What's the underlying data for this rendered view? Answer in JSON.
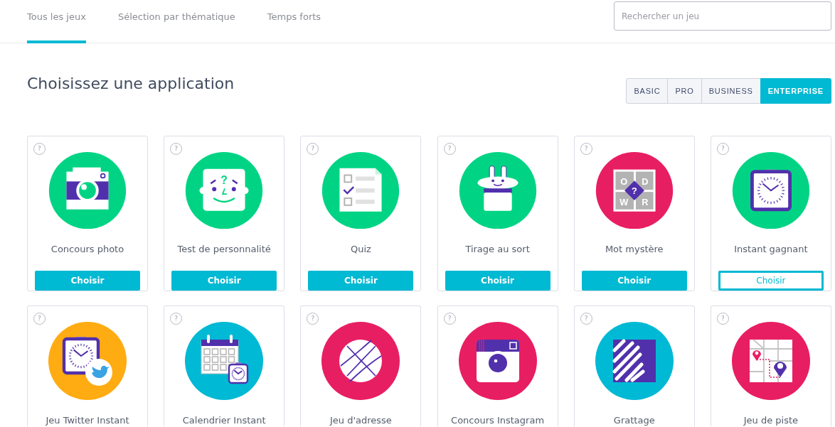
{
  "tabs": [
    {
      "label": "Tous les jeux",
      "selected": true
    },
    {
      "label": "Sélection par thématique",
      "selected": false
    },
    {
      "label": "Temps forts",
      "selected": false
    }
  ],
  "search": {
    "placeholder": "Rechercher un jeu"
  },
  "heading": "Choisissez une application",
  "plans": [
    {
      "label": "BASIC",
      "selected": false
    },
    {
      "label": "PRO",
      "selected": false
    },
    {
      "label": "BUSINESS",
      "selected": false
    },
    {
      "label": "ENTERPRISE",
      "selected": true
    }
  ],
  "games": [
    {
      "title": "Concours photo",
      "help": "?",
      "color": "#00d484",
      "button": {
        "label": "Choisir",
        "outlined": false
      }
    },
    {
      "title": "Test de personnalité",
      "help": "?",
      "color": "#00d484",
      "icon_text": [
        "?"
      ],
      "button": {
        "label": "Choisir",
        "outlined": false
      }
    },
    {
      "title": "Quiz",
      "help": "?",
      "color": "#00d484",
      "button": {
        "label": "Choisir",
        "outlined": false
      }
    },
    {
      "title": "Tirage au sort",
      "help": "?",
      "color": "#00d484",
      "button": {
        "label": "Choisir",
        "outlined": false
      }
    },
    {
      "title": "Mot mystère",
      "help": "?",
      "color": "#e81e63",
      "icon_text": [
        "O",
        "D",
        "W",
        "R",
        "?"
      ],
      "button": {
        "label": "Choisir",
        "outlined": false
      }
    },
    {
      "title": "Instant gagnant",
      "help": "?",
      "color": "#00d484",
      "button": {
        "label": "Choisir",
        "outlined": true
      }
    },
    {
      "title": "Jeu Twitter Instant",
      "help": "?",
      "color": "#ffab12"
    },
    {
      "title": "Calendrier Instant",
      "help": "?",
      "color": "#00b9d4"
    },
    {
      "title": "Jeu d'adresse",
      "help": "?",
      "color": "#e81e63"
    },
    {
      "title": "Concours Instagram",
      "help": "?",
      "color": "#e81e63"
    },
    {
      "title": "Grattage",
      "help": "?",
      "color": "#00b9d4"
    },
    {
      "title": "Jeu de piste",
      "help": "?",
      "color": "#e81e63"
    }
  ]
}
